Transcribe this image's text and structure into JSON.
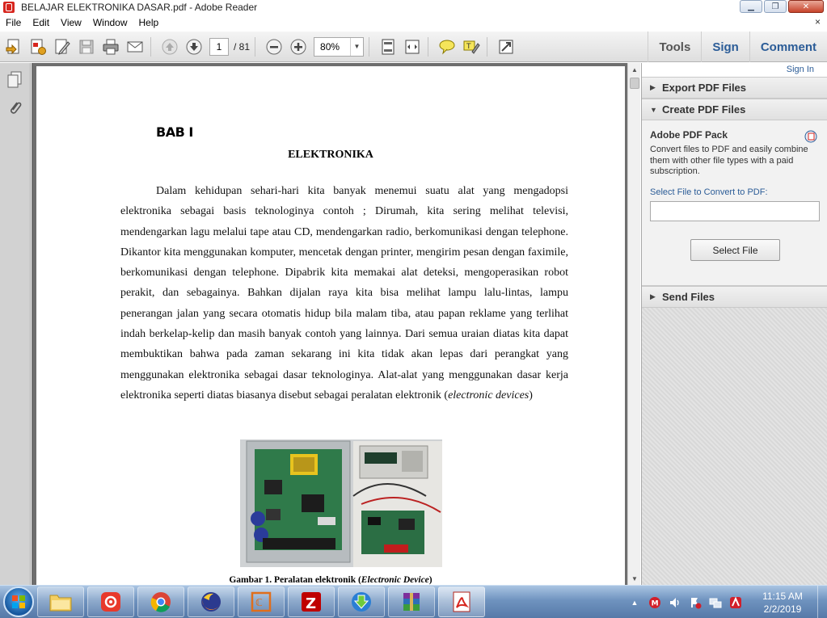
{
  "window": {
    "title": "BELAJAR ELEKTRONIKA DASAR.pdf - Adobe Reader"
  },
  "menu": {
    "items": [
      "File",
      "Edit",
      "View",
      "Window",
      "Help"
    ],
    "close_doc": "×"
  },
  "toolbar": {
    "current_page": "1",
    "total_pages": "/ 81",
    "zoom": "80%",
    "tabs": {
      "tools": "Tools",
      "sign": "Sign",
      "comment": "Comment"
    }
  },
  "document": {
    "chapter": "BAB I",
    "heading": "ELEKTRONIKA",
    "paragraph": "Dalam kehidupan sehari-hari kita banyak menemui suatu alat yang mengadopsi elektronika sebagai basis teknologinya contoh ; Dirumah, kita sering melihat televisi, mendengarkan lagu melalui tape atau CD, mendengarkan radio, berkomunikasi dengan telephone. Dikantor kita menggunakan komputer, mencetak dengan printer, mengirim pesan dengan faximile, berkomunikasi dengan telephone. Dipabrik kita memakai alat deteksi, mengoperasikan robot perakit, dan sebagainya. Bahkan dijalan raya kita bisa melihat lampu lalu-lintas, lampu penerangan jalan yang secara otomatis hidup bila malam tiba, atau papan reklame yang terlihat indah berkelap-kelip dan masih banyak contoh yang lainnya. Dari semua uraian diatas kita dapat membuktikan bahwa pada zaman sekarang ini kita tidak akan lepas dari perangkat yang menggunakan elektronika sebagai dasar teknologinya. Alat-alat yang menggunakan dasar kerja elektronika seperti diatas biasanya disebut sebagai peralatan elektronik (",
    "paragraph_italic": "electronic devices",
    "paragraph_end": ")",
    "caption": "Gambar 1. Peralatan elektronik (",
    "caption_italic": "Electronic Device",
    "caption_end": ")"
  },
  "right_pane": {
    "sign_in": "Sign In",
    "sections": {
      "export": "Export PDF Files",
      "create": "Create PDF Files",
      "send": "Send Files"
    },
    "pack_title": "Adobe PDF Pack",
    "pack_desc": "Convert files to PDF and easily combine them with other file types with a paid subscription.",
    "select_label": "Select File to Convert to PDF:",
    "select_value": "",
    "select_button": "Select File"
  },
  "taskbar": {
    "apps": [
      "file-explorer",
      "screen-recorder",
      "chrome",
      "firefox",
      "office-app",
      "filezilla",
      "internet-download-manager",
      "winrar",
      "adobe-reader"
    ],
    "clock_time": "11:15 AM",
    "clock_date": "2/2/2019"
  },
  "colors": {
    "accent_blue": "#2b5c97",
    "adobe_red": "#d7261f"
  }
}
